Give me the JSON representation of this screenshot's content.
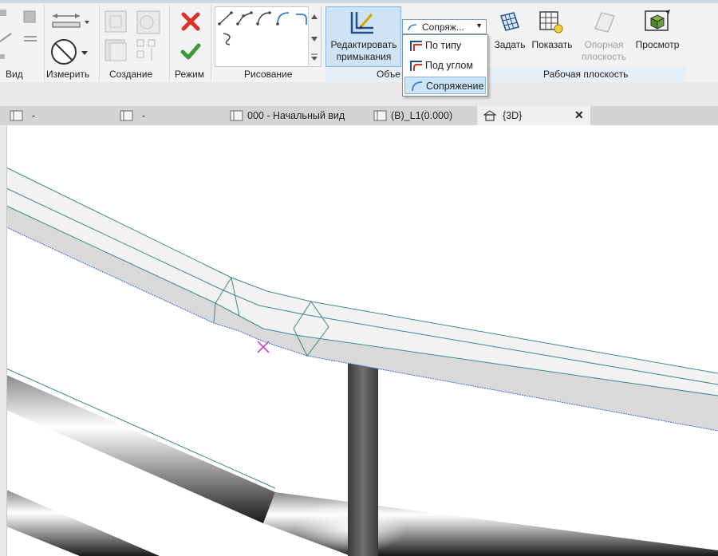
{
  "ribbon": {
    "panels": {
      "view": "Вид",
      "measure": "Измерить",
      "create": "Создание",
      "mode": "Режим",
      "draw": "Рисование",
      "object": "Объе",
      "workplane": "Рабочая плоскость"
    },
    "edit_joins_label_1": "Редактировать",
    "edit_joins_label_2": "примыкания",
    "combo_value": "Сопряж...",
    "set_label": "Задать",
    "show_label": "Показать",
    "ref_plane_label_1": "Опорная",
    "ref_plane_label_2": "плоскость",
    "preview_label": "Просмотр"
  },
  "dropdown": {
    "items": [
      {
        "label": "По типу"
      },
      {
        "label": "Под углом"
      },
      {
        "label": "Сопряжение",
        "selected": true
      }
    ]
  },
  "tabs": [
    {
      "label": "-"
    },
    {
      "label": "-"
    },
    {
      "label": "000 - Начальный вид"
    },
    {
      "label": "(B)_L1(0.000)"
    },
    {
      "label": "{3D}",
      "active": true
    }
  ],
  "tab_close": "✕",
  "colors": {
    "accent_blue": "#3a8fd6",
    "cancel_red": "#d9322a",
    "finish_green": "#3c9a3c",
    "marker_magenta": "#c64fc6",
    "rail_edge": "#3d8a86"
  }
}
